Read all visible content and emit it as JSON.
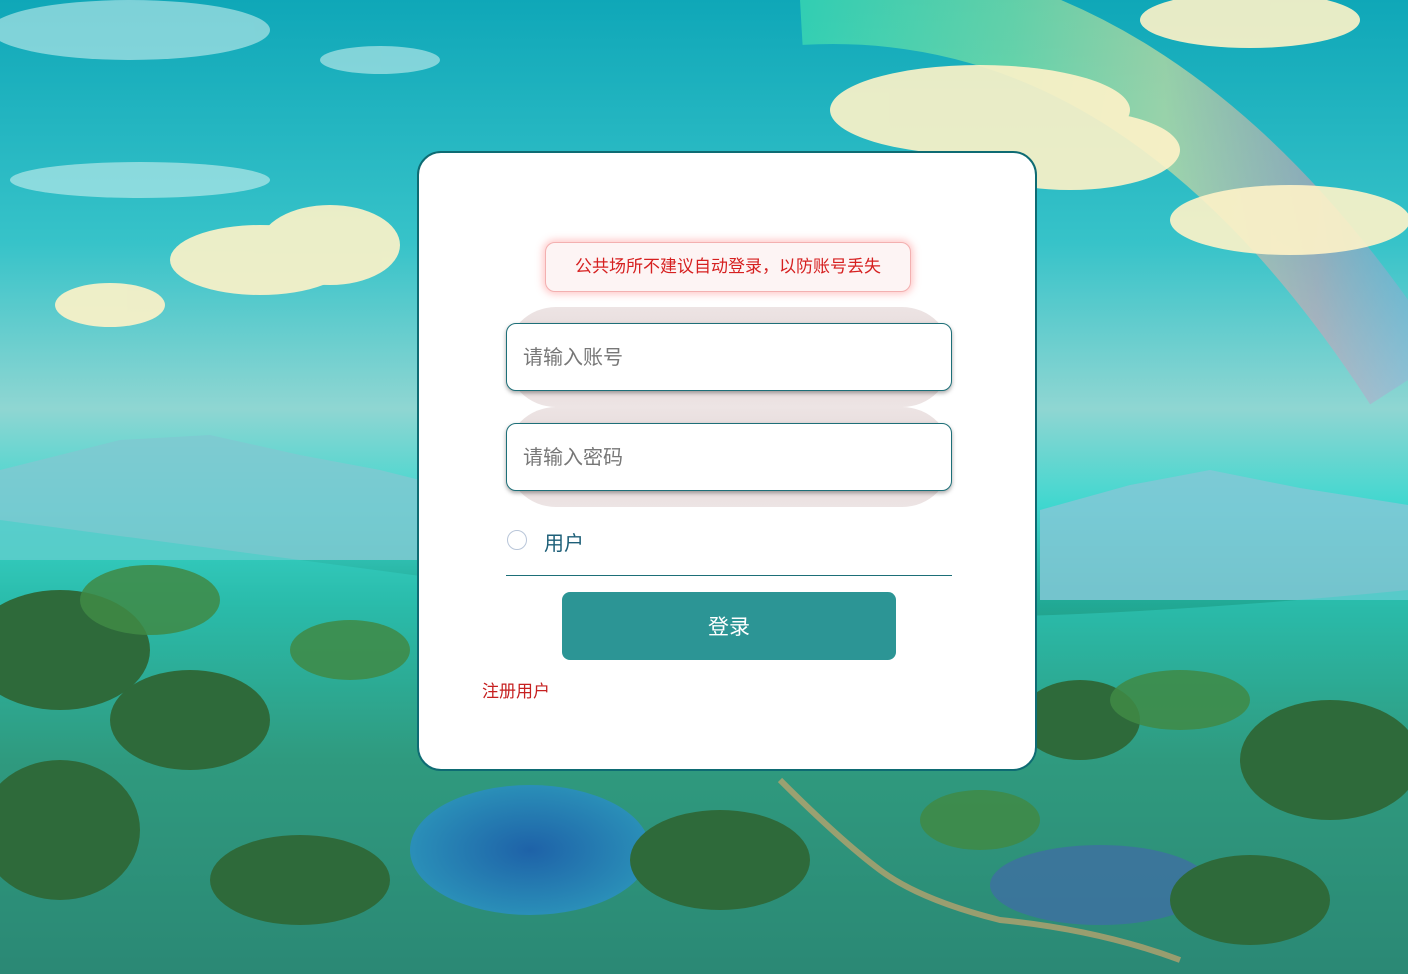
{
  "login": {
    "notice": "公共场所不建议自动登录，以防账号丢失",
    "username_placeholder": "请输入账号",
    "password_placeholder": "请输入密码",
    "role_option": "用户",
    "login_button": "登录",
    "register_link": "注册用户"
  },
  "colors": {
    "card_border": "#0e6b73",
    "button": "#2c9595",
    "notice_text": "#d62020",
    "register_link": "#c62020"
  }
}
